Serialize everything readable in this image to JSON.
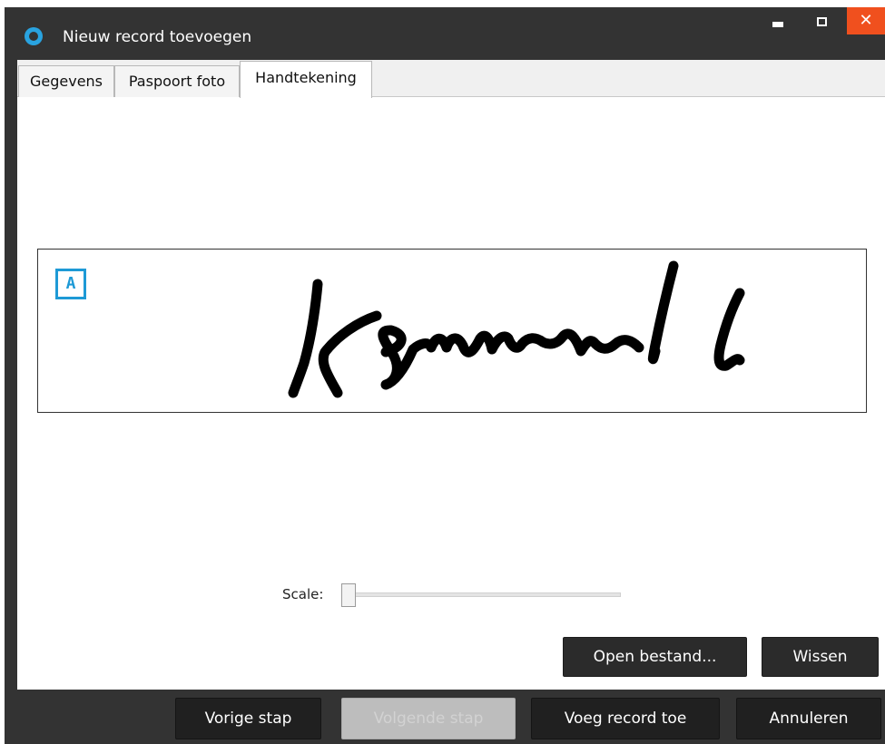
{
  "window": {
    "title": "Nieuw record toevoegen",
    "controls": {
      "minimize": "▬",
      "maximize": "☐",
      "close": "✕"
    },
    "accent_close": "#f0501e",
    "app_icon": "circle-logo-icon"
  },
  "tabs": [
    {
      "label": "Gegevens",
      "active": false
    },
    {
      "label": "Paspoort foto",
      "active": false
    },
    {
      "label": "Handtekening",
      "active": true
    }
  ],
  "signature": {
    "marker": "A",
    "marker_color": "#1e9ad6"
  },
  "scale": {
    "label": "Scale:",
    "value": 0
  },
  "actions": {
    "open_file": "Open bestand...",
    "clear": "Wissen"
  },
  "footer": {
    "previous": "Vorige stap",
    "next": "Volgende stap",
    "next_disabled": true,
    "add_record": "Voeg record toe",
    "cancel": "Annuleren"
  }
}
